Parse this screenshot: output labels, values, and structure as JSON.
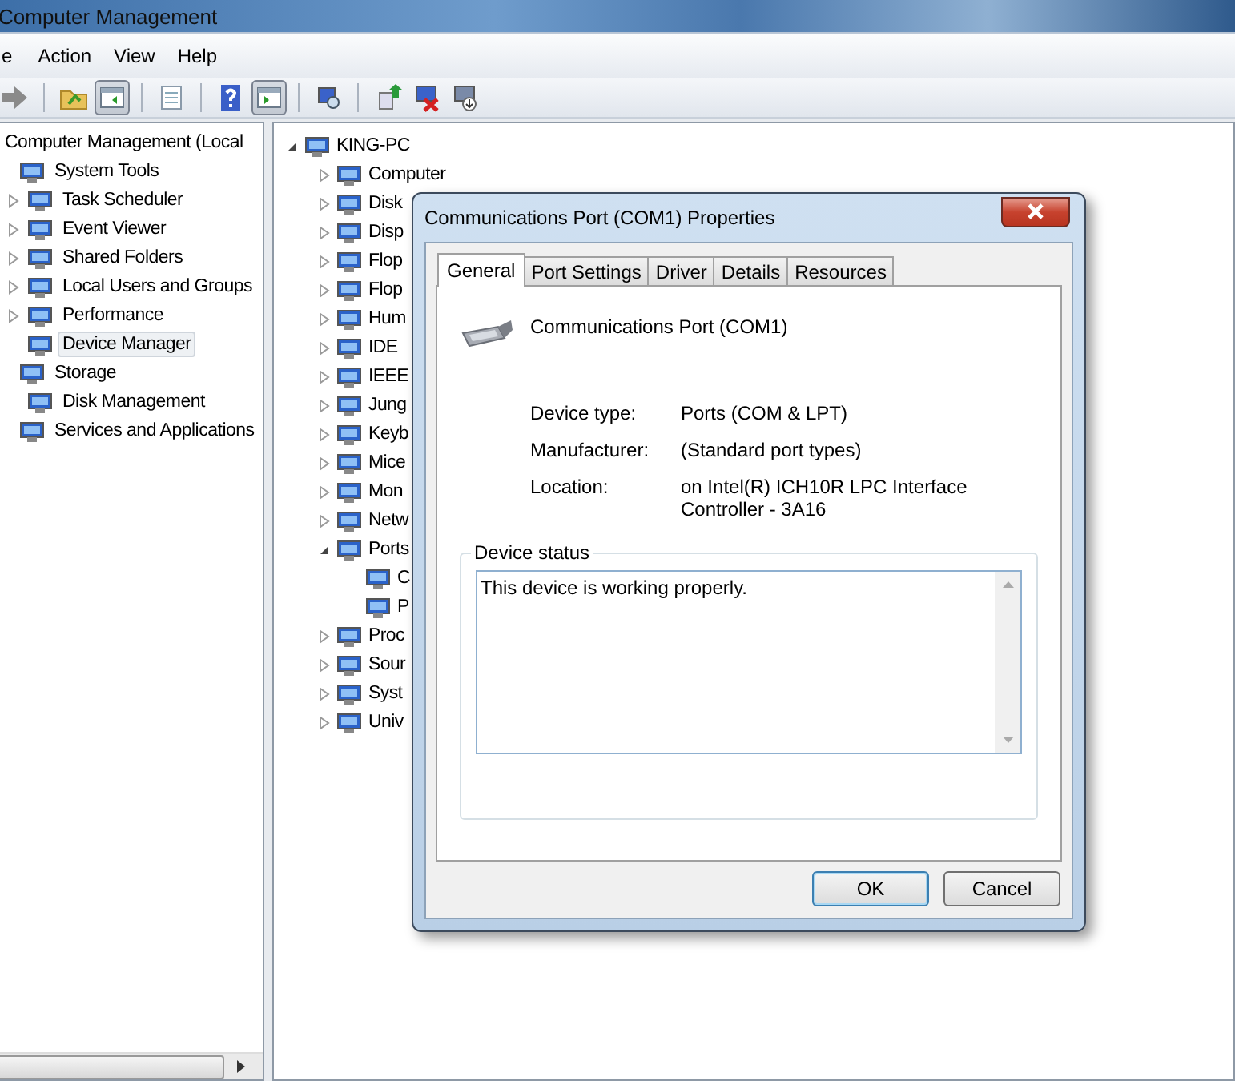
{
  "window": {
    "title": "Computer Management"
  },
  "menu": [
    "e",
    "Action",
    "View",
    "Help"
  ],
  "toolbar": [
    {
      "pressed": false
    },
    {
      "pressed": false
    },
    {
      "pressed": true
    },
    {
      "pressed": false
    },
    {
      "pressed": false
    },
    {
      "pressed": true
    },
    {
      "pressed": false
    },
    {
      "pressed": false
    },
    {
      "pressed": false
    },
    {
      "pressed": false
    }
  ],
  "left_tree": {
    "label": "Computer Management (Local",
    "children": [
      {
        "label": "System Tools",
        "selected": false,
        "children": [
          {
            "label": "Task Scheduler",
            "expanded": false,
            "selected": false
          },
          {
            "label": "Event Viewer",
            "expanded": false,
            "selected": false
          },
          {
            "label": "Shared Folders",
            "expanded": false,
            "selected": false
          },
          {
            "label": "Local Users and Groups",
            "expanded": false,
            "selected": false
          },
          {
            "label": "Performance",
            "expanded": false,
            "selected": false
          },
          {
            "label": "Device Manager",
            "selected": true
          }
        ]
      },
      {
        "label": "Storage",
        "selected": false,
        "children": [
          {
            "label": "Disk Management",
            "selected": false
          }
        ]
      },
      {
        "label": "Services and Applications",
        "selected": false
      }
    ]
  },
  "right_tree": {
    "label": "KING-PC",
    "expanded": true,
    "selected": false,
    "children": [
      {
        "label": "Computer",
        "expanded": false,
        "selected": false
      },
      {
        "label": "Disk",
        "expanded": false,
        "selected": false
      },
      {
        "label": "Disp",
        "expanded": false,
        "selected": false
      },
      {
        "label": "Flop",
        "expanded": false,
        "selected": false
      },
      {
        "label": "Flop",
        "expanded": false,
        "selected": false
      },
      {
        "label": "Hum",
        "expanded": false,
        "selected": false
      },
      {
        "label": "IDE",
        "expanded": false,
        "selected": false
      },
      {
        "label": "IEEE",
        "expanded": false,
        "selected": false
      },
      {
        "label": "Jung",
        "expanded": false,
        "selected": false
      },
      {
        "label": "Keyb",
        "expanded": false,
        "selected": false
      },
      {
        "label": "Mice",
        "expanded": false,
        "selected": false
      },
      {
        "label": "Mon",
        "expanded": false,
        "selected": false
      },
      {
        "label": "Netw",
        "expanded": false,
        "selected": false
      },
      {
        "label": "Ports",
        "expanded": true,
        "selected": false,
        "children": [
          {
            "label": "C",
            "selected": false
          },
          {
            "label": "P",
            "selected": false
          }
        ]
      },
      {
        "label": "Proc",
        "expanded": false,
        "selected": false
      },
      {
        "label": "Sour",
        "expanded": false,
        "selected": false
      },
      {
        "label": "Syst",
        "expanded": false,
        "selected": false
      },
      {
        "label": "Univ",
        "expanded": false,
        "selected": false
      }
    ]
  },
  "dialog": {
    "title": "Communications Port (COM1) Properties",
    "tabs": [
      {
        "label": "General",
        "selected": true
      },
      {
        "label": "Port Settings",
        "selected": false
      },
      {
        "label": "Driver",
        "selected": false
      },
      {
        "label": "Details",
        "selected": false
      },
      {
        "label": "Resources",
        "selected": false
      }
    ],
    "device_name": "Communications Port (COM1)",
    "properties": [
      {
        "label": "Device type:",
        "value": "Ports (COM & LPT)"
      },
      {
        "label": "Manufacturer:",
        "value": "(Standard port types)"
      },
      {
        "label": "Location:",
        "value": "on Intel(R) ICH10R LPC Interface Controller - 3A16"
      }
    ],
    "status_group": {
      "title": "Device status",
      "text": "This device is working properly."
    },
    "buttons": [
      {
        "label": "OK",
        "default": true
      },
      {
        "label": "Cancel",
        "default": false
      }
    ]
  }
}
